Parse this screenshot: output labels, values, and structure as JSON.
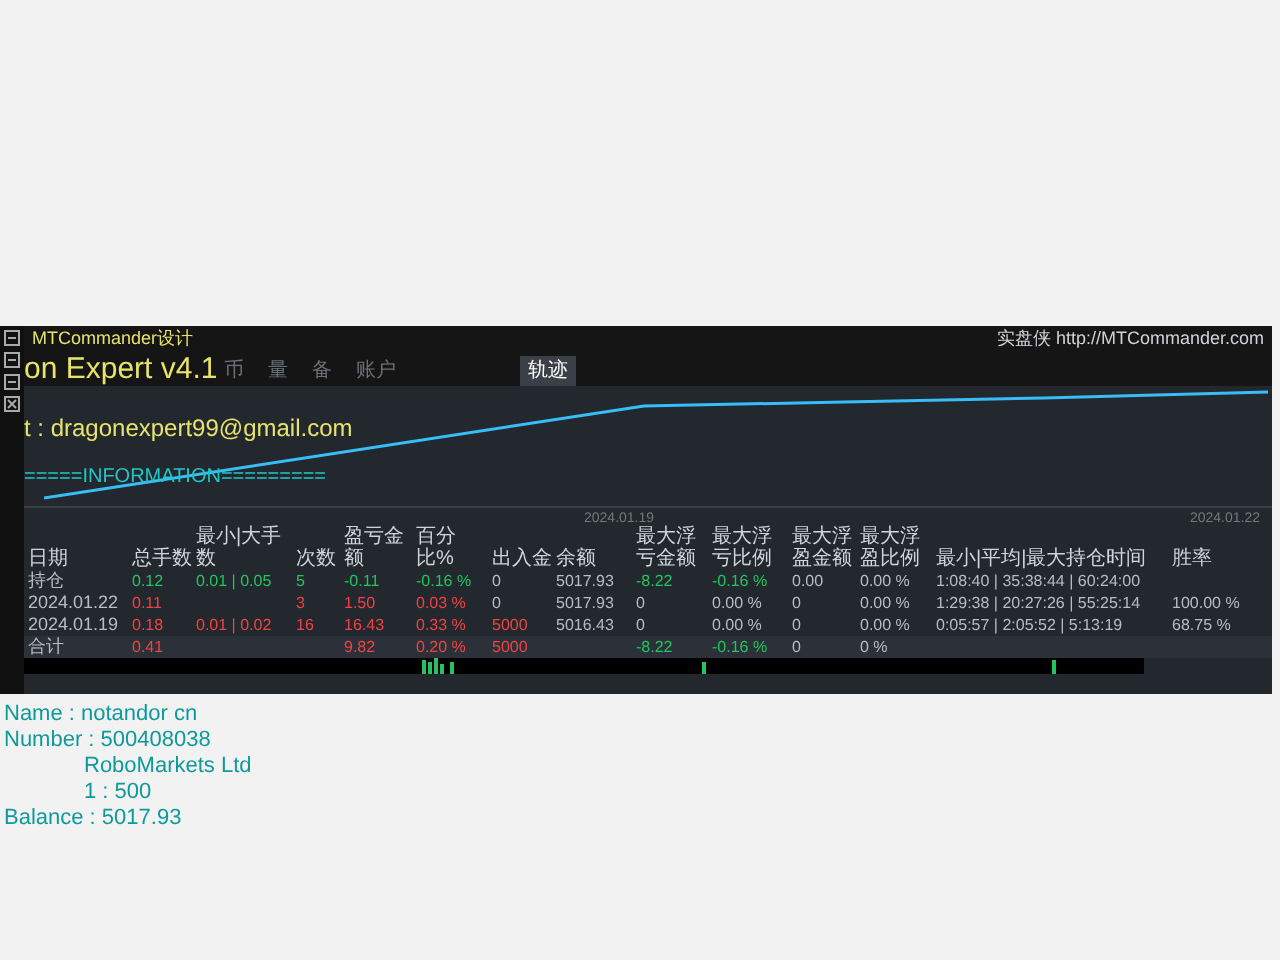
{
  "window": {
    "title": "MTCommander设计",
    "site": "实盘侠 http://MTCommander.com"
  },
  "tabs": [
    {
      "label": "币",
      "selected": false
    },
    {
      "label": "量",
      "selected": false
    },
    {
      "label": "备",
      "selected": false
    },
    {
      "label": "账户",
      "selected": false
    },
    {
      "label": "轨迹",
      "selected": true
    }
  ],
  "chart": {
    "start_date": "2024.01.19",
    "end_date": "2024.01.22"
  },
  "overlay": {
    "title": "on Expert v4.1",
    "contact": "t : dragonexpert99@gmail.com",
    "section": "=====INFORMATION=========",
    "name": "Name   :   notandor cn",
    "number": "Number  :  500408038",
    "broker": "RoboMarkets Ltd",
    "leverage": "1 : 500",
    "balance": "Balance  :  5017.93"
  },
  "table": {
    "columns": [
      "日期",
      "总手数",
      "最小|大手数",
      "次数",
      "盈亏金额",
      "百分比%",
      "出入金",
      "余额",
      "最大浮亏金额",
      "最大浮亏比例",
      "最大浮盈金额",
      "最大浮盈比例",
      "最小|平均|最大持仓时间",
      "胜率"
    ],
    "rows": [
      {
        "cells": [
          {
            "text": "持仓",
            "kind": "plain"
          },
          {
            "text": "0.12",
            "kind": "up"
          },
          {
            "text": "0.01 | 0.05",
            "kind": "up"
          },
          {
            "text": "5",
            "kind": "up"
          },
          {
            "text": "-0.11",
            "kind": "up"
          },
          {
            "text": "-0.16 %",
            "kind": "up"
          },
          {
            "text": "0",
            "kind": "plain"
          },
          {
            "text": "5017.93",
            "kind": "plain"
          },
          {
            "text": "-8.22",
            "kind": "up"
          },
          {
            "text": "-0.16 %",
            "kind": "up"
          },
          {
            "text": "0.00",
            "kind": "plain"
          },
          {
            "text": "0.00 %",
            "kind": "plain"
          },
          {
            "text": "1:08:40 | 35:38:44 | 60:24:00",
            "kind": "plain"
          },
          {}
        ]
      },
      {
        "cells": [
          {
            "text": "2024.01.22",
            "kind": "plain"
          },
          {
            "text": "0.11",
            "kind": "down"
          },
          {},
          {
            "text": "3",
            "kind": "down"
          },
          {
            "text": "1.50",
            "kind": "down"
          },
          {
            "text": "0.03 %",
            "kind": "down"
          },
          {
            "text": "0",
            "kind": "plain"
          },
          {
            "text": "5017.93",
            "kind": "plain"
          },
          {
            "text": "0",
            "kind": "plain"
          },
          {
            "text": "0.00 %",
            "kind": "plain"
          },
          {
            "text": "0",
            "kind": "plain"
          },
          {
            "text": "0.00 %",
            "kind": "plain"
          },
          {
            "text": "1:29:38 | 20:27:26 | 55:25:14",
            "kind": "plain"
          },
          {
            "text": "100.00 %",
            "kind": "plain"
          }
        ]
      },
      {
        "cells": [
          {
            "text": "2024.01.19",
            "kind": "plain"
          },
          {
            "text": "0.18",
            "kind": "down"
          },
          {
            "text": "0.01 | 0.02",
            "kind": "down"
          },
          {
            "text": "16",
            "kind": "down"
          },
          {
            "text": "16.43",
            "kind": "down"
          },
          {
            "text": "0.33 %",
            "kind": "down"
          },
          {
            "text": "5000",
            "kind": "down"
          },
          {
            "text": "5016.43",
            "kind": "plain"
          },
          {
            "text": "0",
            "kind": "plain"
          },
          {
            "text": "0.00 %",
            "kind": "plain"
          },
          {
            "text": "0",
            "kind": "plain"
          },
          {
            "text": "0.00 %",
            "kind": "plain"
          },
          {
            "text": "0:05:57 | 2:05:52 | 5:13:19",
            "kind": "plain"
          },
          {
            "text": "68.75 %",
            "kind": "plain"
          }
        ]
      },
      {
        "cells": [
          {
            "text": "合计",
            "kind": "plain"
          },
          {
            "text": "0.41",
            "kind": "down"
          },
          {},
          {},
          {
            "text": "9.82",
            "kind": "down"
          },
          {
            "text": "0.20 %",
            "kind": "down"
          },
          {
            "text": "5000",
            "kind": "down"
          },
          {},
          {
            "text": "-8.22",
            "kind": "up"
          },
          {
            "text": "-0.16 %",
            "kind": "up"
          },
          {
            "text": "0",
            "kind": "plain"
          },
          {
            "text": "0 %",
            "kind": "plain"
          },
          {},
          {}
        ]
      }
    ]
  }
}
